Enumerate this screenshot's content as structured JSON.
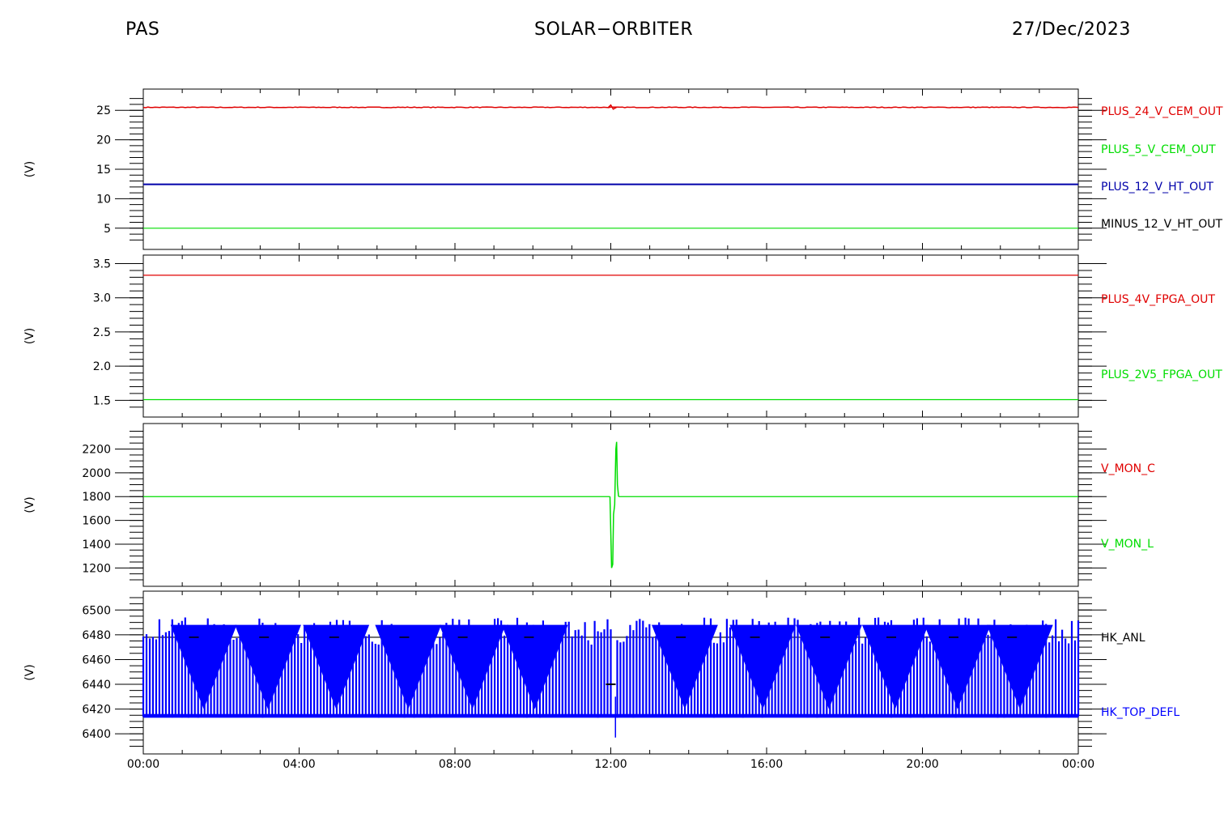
{
  "header": {
    "instrument": "PAS",
    "mission": "SOLAR−ORBITER",
    "date": "27/Dec/2023"
  },
  "chart_data": [
    {
      "type": "line",
      "ylabel": "(V)",
      "ylim": [
        2.5,
        27.5
      ],
      "yticks": [
        5,
        10,
        15,
        20,
        25
      ],
      "minor_step": 1,
      "series": [
        {
          "name": "PLUS_24_V_CEM_OUT",
          "color": "#e00000",
          "value": 25.5,
          "noise": 0.12,
          "spike": {
            "x": 12.0,
            "values": [
              25.9,
              25.2
            ]
          }
        },
        {
          "name": "PLUS_5_V_CEM_OUT",
          "color": "#00dd00",
          "value": 5.0
        },
        {
          "name": "PLUS_12_V_HT_OUT",
          "color": "#0000aa",
          "value": 12.45,
          "width": 2
        },
        {
          "name": "MINUS_12_V_HT_OUT",
          "color": "#000000",
          "value": null
        }
      ]
    },
    {
      "type": "line",
      "ylabel": "(V)",
      "ylim": [
        1.35,
        3.53
      ],
      "yticks": [
        "1.5",
        "2.0",
        "2.5",
        "3.0",
        "3.5"
      ],
      "minor_step": 0.1,
      "series": [
        {
          "name": "PLUS_4V_FPGA_OUT",
          "color": "#e00000",
          "value": 3.33
        },
        {
          "name": "PLUS_2V5_FPGA_OUT",
          "color": "#00dd00",
          "value": 1.51
        }
      ]
    },
    {
      "type": "line",
      "ylabel": "(V)",
      "ylim": [
        1100,
        2360
      ],
      "yticks": [
        1200,
        1400,
        1600,
        1800,
        2000,
        2200
      ],
      "minor_step": 50,
      "series": [
        {
          "name": "V_MON_C",
          "color": "#e00000",
          "value": null
        },
        {
          "name": "V_MON_L",
          "color": "#00dd00",
          "value": 1800,
          "excursion": [
            [
              11.98,
              1800
            ],
            [
              12.02,
              1200
            ],
            [
              12.05,
              1230
            ],
            [
              12.07,
              1650
            ],
            [
              12.1,
              1730
            ],
            [
              12.13,
              2200
            ],
            [
              12.15,
              2260
            ],
            [
              12.17,
              1900
            ],
            [
              12.2,
              1800
            ]
          ]
        }
      ]
    },
    {
      "type": "line",
      "ylabel": "(V)",
      "ylim": [
        6389,
        6510
      ],
      "yticks": [
        6400,
        6420,
        6440,
        6460,
        6480,
        6500
      ],
      "minor_step": 5,
      "series": [
        {
          "name": "HK_ANL",
          "color": "#000000",
          "value": 6478
        },
        {
          "name": "HK_TOP_DEFL",
          "color": "#0000ff",
          "min": 6413,
          "max": 6494,
          "dip_centers": [
            1.55,
            3.2,
            4.95,
            6.8,
            8.45,
            10.05,
            13.9,
            15.9,
            17.6,
            19.3,
            20.9,
            22.5
          ],
          "dip_floor": 6420,
          "gap": [
            12.0,
            12.15
          ],
          "spike": {
            "x": 12.12,
            "values": [
              6397,
              6430
            ]
          }
        }
      ]
    }
  ],
  "x_axis": {
    "range_hours": [
      0,
      24
    ],
    "ticks": [
      "00:00",
      "04:00",
      "08:00",
      "12:00",
      "16:00",
      "20:00",
      "00:00"
    ]
  }
}
